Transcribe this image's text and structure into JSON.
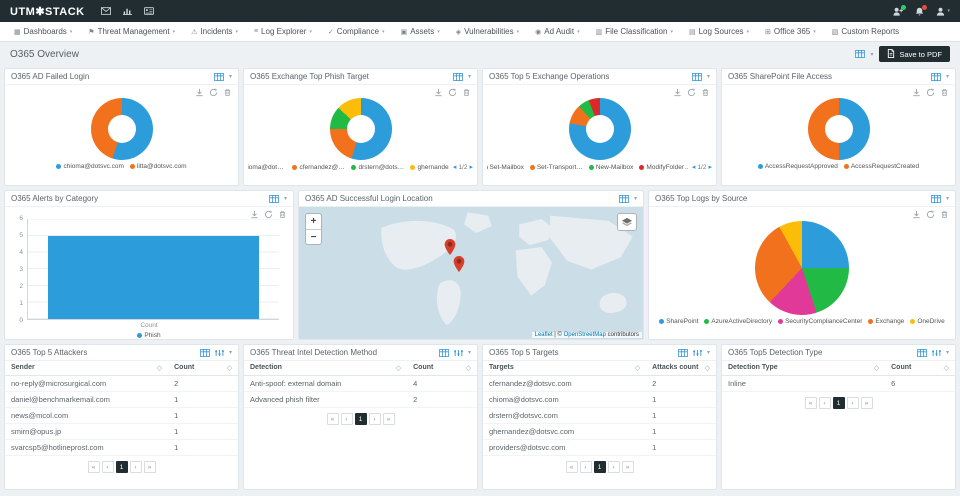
{
  "theme": {
    "navbar_bg": "#222d32",
    "accent_blue": "#3498db",
    "chart_blue": "#2d9cdb",
    "chart_orange": "#f2711c",
    "chart_green": "#21ba45",
    "chart_yellow": "#fbbd08",
    "chart_red": "#db2828",
    "chart_pink": "#e03997"
  },
  "glyphs": {
    "caret": "▾",
    "sort": "◇"
  },
  "topbar": {
    "brand": "UTM✱STACK",
    "left_icons": [
      {
        "name": "mail-icon",
        "icon": "mail"
      },
      {
        "name": "bar-chart-icon",
        "icon": "bar-chart"
      },
      {
        "name": "id-card-icon",
        "icon": "id-card"
      }
    ],
    "right_icons": [
      {
        "name": "add-user-icon",
        "icon": "user-plus",
        "dot": "#2ecc71"
      },
      {
        "name": "notifications-bell-icon",
        "icon": "bell",
        "dot": "#e74c3c"
      },
      {
        "name": "user-menu-icon",
        "icon": "user",
        "caret": true
      }
    ]
  },
  "menu": {
    "items": [
      {
        "label": "Dashboards",
        "glyph": "▦",
        "caret": true
      },
      {
        "label": "Threat Management",
        "glyph": "⚑",
        "caret": true
      },
      {
        "label": "Incidents",
        "glyph": "⚠",
        "caret": true
      },
      {
        "label": "Log Explorer",
        "glyph": "≡",
        "caret": true
      },
      {
        "label": "Compliance",
        "glyph": "✓",
        "caret": true
      },
      {
        "label": "Assets",
        "glyph": "▣",
        "caret": true
      },
      {
        "label": "Vulnerabilities",
        "glyph": "◈",
        "caret": true
      },
      {
        "label": "Ad Audit",
        "glyph": "◉",
        "caret": true
      },
      {
        "label": "File Classification",
        "glyph": "▥",
        "caret": true
      },
      {
        "label": "Log Sources",
        "glyph": "▤",
        "caret": true
      },
      {
        "label": "Office 365",
        "glyph": "⊞",
        "caret": true
      },
      {
        "label": "Custom Reports",
        "glyph": "▧",
        "caret": false
      }
    ]
  },
  "page": {
    "title": "O365 Overview",
    "save_pdf_label": "Save to PDF"
  },
  "legend_pager": {
    "prev": "◂",
    "label": "1/2",
    "next": "▸"
  },
  "pagination": {
    "first": "«",
    "prev": "‹",
    "page": "1",
    "next": "›",
    "last": "»"
  },
  "panels": {
    "map": {
      "title": "O365 AD Successful Login Location"
    }
  },
  "map": {
    "zoom_in": "+",
    "zoom_out": "−",
    "attr_leaflet": "Leaflet",
    "attr_sep": " | © ",
    "attr_osm": "OpenStreetMap",
    "attr_contrib": " contributors"
  },
  "chart_data": [
    {
      "type": "donut",
      "title": "O365 AD Failed Login",
      "labels": [
        "chioma@dotsvc.com",
        "litta@dotsvc.com"
      ],
      "values": [
        55,
        45
      ],
      "colors": [
        "#2d9cdb",
        "#f2711c"
      ],
      "legend_position": "bottom"
    },
    {
      "type": "donut",
      "title": "O365 Exchange Top Phish Target",
      "labels": [
        "chioma@dotsvc.com",
        "cfernandez@dotsvc.com",
        "drstern@dotsvc.com",
        "ghernandez@dotsvc.com"
      ],
      "values": [
        55,
        20,
        12,
        13
      ],
      "colors": [
        "#2d9cdb",
        "#f2711c",
        "#21ba45",
        "#fbbd08"
      ],
      "legend_pages": "1/2",
      "legend_position": "bottom"
    },
    {
      "type": "donut",
      "title": "O365 Top 5 Exchange Operations",
      "labels": [
        "Set-Mailbox",
        "Set-TransportConfig",
        "New-Mailbox",
        "ModifyFolderPermissions"
      ],
      "values": [
        78,
        10,
        6,
        6
      ],
      "colors": [
        "#2d9cdb",
        "#f2711c",
        "#21ba45",
        "#db2828"
      ],
      "legend_pages": "1/2",
      "legend_position": "bottom"
    },
    {
      "type": "donut",
      "title": "O365 SharePoint File Access",
      "labels": [
        "AccessRequestApproved",
        "AccessRequestCreated"
      ],
      "values": [
        50,
        50
      ],
      "colors": [
        "#2d9cdb",
        "#f2711c"
      ],
      "legend_position": "bottom"
    },
    {
      "type": "bar",
      "title": "O365 Alerts by Category",
      "categories": [
        "Count"
      ],
      "series": [
        {
          "name": "Phish",
          "values": [
            5
          ]
        }
      ],
      "color": "#2d9cdb",
      "ylim": [
        0,
        6
      ],
      "yticks": [
        6,
        5,
        4,
        3,
        2,
        1,
        0
      ],
      "xlabel": "Count",
      "grid": true,
      "legend_position": "bottom"
    },
    {
      "type": "pie",
      "title": "O365 Top Logs by Source",
      "labels": [
        "SharePoint",
        "AzureActiveDirectory",
        "SecurityComplianceCenter",
        "Exchange",
        "OneDrive"
      ],
      "values": [
        25,
        20,
        17,
        30,
        8
      ],
      "colors": [
        "#2d9cdb",
        "#21ba45",
        "#e03997",
        "#f2711c",
        "#fbbd08"
      ],
      "legend_position": "bottom"
    }
  ],
  "tables": {
    "attackers": {
      "title": "O365 Top 5 Attackers",
      "headers": [
        "Sender",
        "Count"
      ],
      "rows": [
        [
          "no-reply@microsurgical.com",
          "2"
        ],
        [
          "daniel@benchmarkemail.com",
          "1"
        ],
        [
          "news@mcol.com",
          "1"
        ],
        [
          "smirn@opus.jp",
          "1"
        ],
        [
          "svarcsp5@hotlineprost.com",
          "1"
        ]
      ]
    },
    "detection_method": {
      "title": "O365 Threat Intel Detection Method",
      "headers": [
        "Detection",
        "Count"
      ],
      "rows": [
        [
          "Anti-spoof: external domain",
          "4"
        ],
        [
          "Advanced phish filter",
          "2"
        ]
      ]
    },
    "targets": {
      "title": "O365 Top 5 Targets",
      "headers": [
        "Targets",
        "Attacks count"
      ],
      "rows": [
        [
          "cfernandez@dotsvc.com",
          "2"
        ],
        [
          "chioma@dotsvc.com",
          "1"
        ],
        [
          "drstern@dotsvc.com",
          "1"
        ],
        [
          "ghernandez@dotsvc.com",
          "1"
        ],
        [
          "providers@dotsvc.com",
          "1"
        ]
      ]
    },
    "detection_type": {
      "title": "O365 Top5 Detection Type",
      "headers": [
        "Detection Type",
        "Count"
      ],
      "rows": [
        [
          "Inline",
          "6"
        ]
      ]
    }
  }
}
